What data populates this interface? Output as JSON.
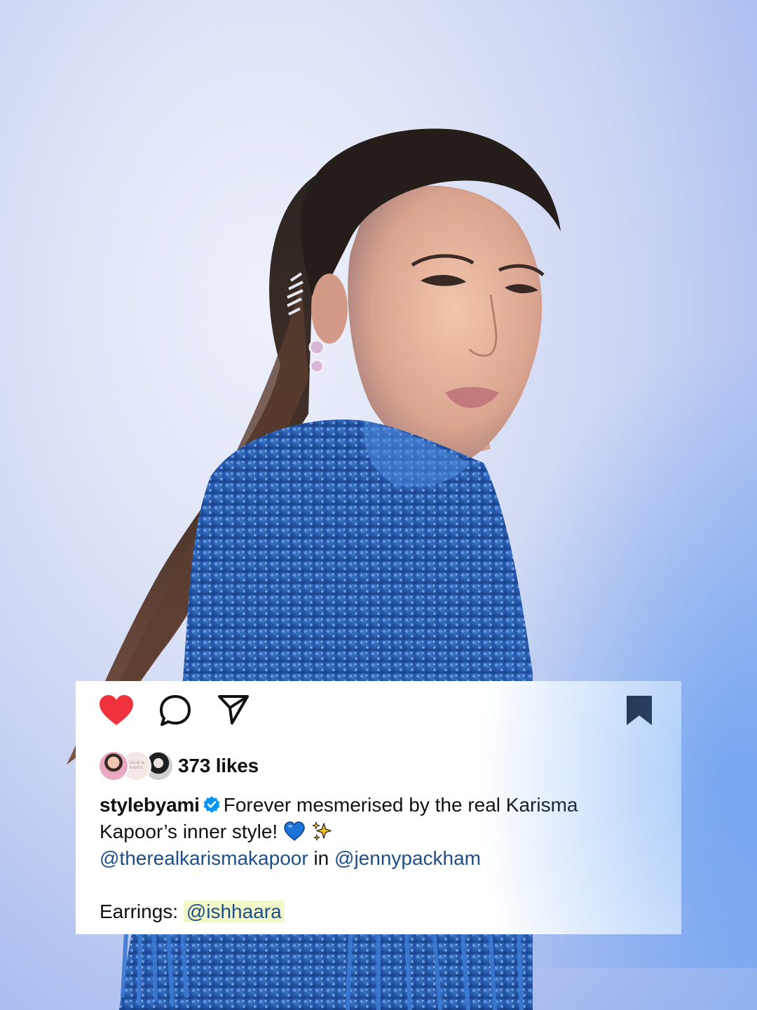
{
  "post": {
    "likes": "373 likes",
    "username": "stylebyami",
    "caption_text_1": "Forever mesmerised by the real Karisma",
    "caption_text_2": "Kapoor’s inner style!",
    "mention_1": "@therealkarismakapoor",
    "mention_joiner": "in",
    "mention_2": "@jennypackham",
    "earrings_label": "Earrings:",
    "earrings_mention": "@ishhaara",
    "liked_by_avatar_2_text": "GAUR & NAINA"
  },
  "icons": {
    "like": "heart-filled-icon",
    "comment": "comment-bubble-icon",
    "share": "paper-plane-icon",
    "save": "bookmark-filled-icon",
    "verified": "verified-badge-icon",
    "emoji_1": "blue-heart-emoji",
    "emoji_2": "sparkles-emoji"
  },
  "colors": {
    "heart": "#f0323f",
    "verified": "#0095f6",
    "mention": "#1d4e89",
    "highlight": "#f2f8c7",
    "text": "#111111",
    "background_glow": "#a9bdf0"
  }
}
